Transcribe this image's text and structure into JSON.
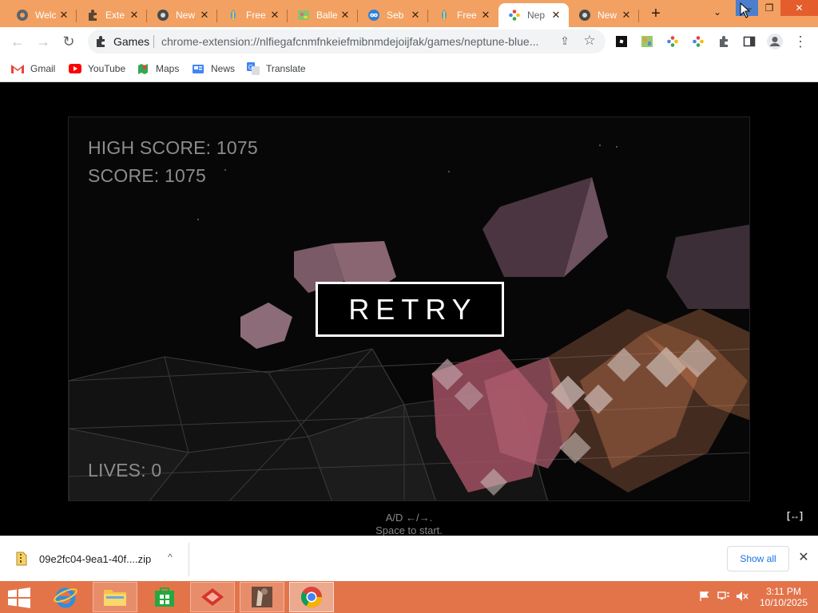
{
  "browser": {
    "tabs": [
      {
        "title": "Welc",
        "icon": "globe-icon",
        "active": false
      },
      {
        "title": "Exte",
        "icon": "puzzle-icon",
        "active": false
      },
      {
        "title": "New",
        "icon": "chrome-icon",
        "active": false
      },
      {
        "title": "Free",
        "icon": "leaf-icon",
        "active": false
      },
      {
        "title": "Balle",
        "icon": "game-thumb-icon",
        "active": false
      },
      {
        "title": "Seb",
        "icon": "infinity-icon",
        "active": false
      },
      {
        "title": "Free",
        "icon": "leaf-icon",
        "active": false
      },
      {
        "title": "Nep",
        "icon": "dots-icon",
        "active": true
      },
      {
        "title": "New",
        "icon": "chrome-icon",
        "active": false
      }
    ],
    "tab_close_glyph": "✕",
    "new_tab_glyph": "+",
    "tab_search_glyph": "⌄",
    "window_controls": {
      "minimize": "—",
      "maximize": "❐",
      "close": "✕"
    },
    "toolbar": {
      "back_glyph": "←",
      "forward_glyph": "→",
      "reload_glyph": "↻",
      "site_chip": "Games",
      "url": "chrome-extension://nlfiegafcnmfnkeiefmibnmdejoijfak/games/neptune-blue...",
      "share_glyph": "⇪",
      "star_glyph": "☆",
      "menu_glyph": "⋮"
    },
    "bookmarks": [
      {
        "label": "Gmail",
        "icon": "gmail-icon"
      },
      {
        "label": "YouTube",
        "icon": "youtube-icon"
      },
      {
        "label": "Maps",
        "icon": "maps-icon"
      },
      {
        "label": "News",
        "icon": "news-icon"
      },
      {
        "label": "Translate",
        "icon": "translate-icon"
      }
    ]
  },
  "game": {
    "high_score": "HIGH SCORE: 1075",
    "score": "SCORE: 1075",
    "lives": "LIVES: 0",
    "retry_label": "RETRY",
    "instructions_line1": "A/D ←/→.",
    "instructions_line2": "Space to start.",
    "fullscreen_toggle": "[↔]"
  },
  "downloads": {
    "file_name": "09e2fc04-9ea1-40f....zip",
    "caret": "^",
    "show_all": "Show all",
    "close_glyph": "✕"
  },
  "taskbar": {
    "time": "3:11 PM",
    "date": "10/10/2025"
  },
  "colors": {
    "tabstrip": "#f2a162",
    "taskbar": "#e3744a",
    "accent_blue": "#1a73e8"
  }
}
